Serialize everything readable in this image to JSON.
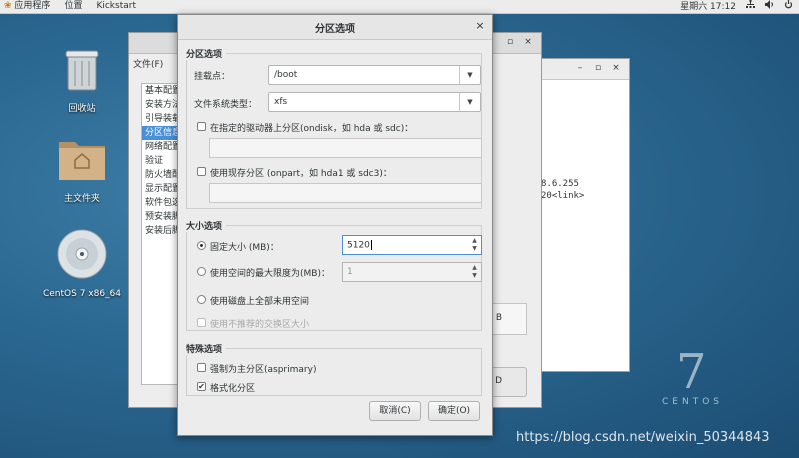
{
  "topbar": {
    "apps": "应用程序",
    "places": "位置",
    "app_name": "Kickstart",
    "clock": "星期六 17:12",
    "network_icon": "network-icon",
    "volume_icon": "volume-icon",
    "power_icon": "power-icon"
  },
  "desktop": {
    "trash": "回收站",
    "home": "主文件夹",
    "disc": "CentOS 7 x86_64",
    "brand_number": "7",
    "brand_word": "CENTOS",
    "watermark": "https://blog.csdn.net/weixin_50344843"
  },
  "kickstart": {
    "menu_file": "文件(F)",
    "nav": [
      "基本配置",
      "安装方法",
      "引导装载",
      "分区信息",
      "网络配置",
      "验证",
      "防火墙配",
      "显示配置",
      "软件包选",
      "预安装脚",
      "安装后脚"
    ],
    "partial_b": "B",
    "partial_d": "D"
  },
  "terminal": {
    "line1": "8.6.255",
    "line2": "20<link>"
  },
  "dialog": {
    "title": "分区选项",
    "section_partition": "分区选项",
    "mount_label": "挂载点：",
    "mount_value": "/boot",
    "fs_label": "文件系统类型：",
    "fs_value": "xfs",
    "ondisk_label": "在指定的驱动器上分区(ondisk，如 hda 或 sdc)：",
    "onpart_label": "使用现存分区 (onpart，如 hda1 或 sdc3)：",
    "section_size": "大小选项",
    "fixed_label": "固定大小 (MB)：",
    "fixed_value": "5120",
    "max_label": "使用空间的最大限度为(MB)：",
    "max_value": "1",
    "fill_label": "使用磁盘上全部未用空间",
    "recommended_label": "使用不推荐的交换区大小",
    "section_special": "特殊选项",
    "primary_label": "强制为主分区(asprimary)",
    "format_label": "格式化分区",
    "cancel": "取消(C)",
    "ok": "确定(O)"
  }
}
